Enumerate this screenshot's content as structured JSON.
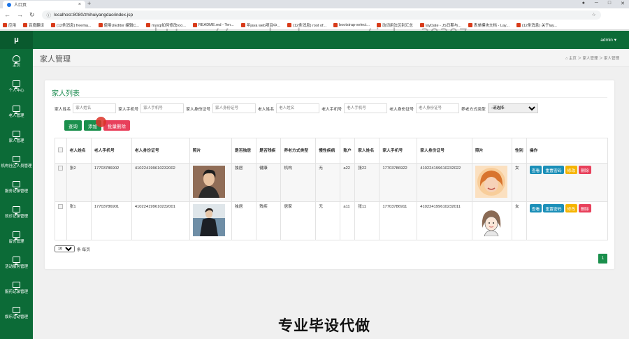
{
  "browser": {
    "tab_title": "人口页",
    "url": "localhost:8080/zhihuiyangdao/index.jsp",
    "bookmarks": [
      "应用",
      "百度翻译",
      "(12条消息) freema...",
      "使用UEditor 编辑C...",
      "mysql如何修改roo...",
      "README.md - Ten...",
      "年java web项目中...",
      "(12条消息) root of...",
      "bootstrap-select...",
      "动词用法区别汇总",
      "layDate - JS日期与...",
      "表单模块文档 - Lay...",
      "(12条消息) 关于lay..."
    ]
  },
  "watermark_text": "https://www.huzhan.com/ishop39397",
  "bottom_watermark": "专业毕设代做",
  "sidebar": {
    "logo": "μ",
    "items": [
      {
        "label": "主页",
        "icon": "dashboard-icon"
      },
      {
        "label": "个人中心",
        "icon": "monitor-icon"
      },
      {
        "label": "老人管理",
        "icon": "monitor-icon"
      },
      {
        "label": "家人管理",
        "icon": "monitor-icon"
      },
      {
        "label": "机构社区人员管理",
        "icon": "monitor-icon"
      },
      {
        "label": "服务记录管理",
        "icon": "monitor-icon"
      },
      {
        "label": "就诊记录管理",
        "icon": "monitor-icon"
      },
      {
        "label": "留言管理",
        "icon": "monitor-icon"
      },
      {
        "label": "活动服务管理",
        "icon": "monitor-icon"
      },
      {
        "label": "服药记录管理",
        "icon": "monitor-icon"
      },
      {
        "label": "娱乐活动管理",
        "icon": "monitor-icon"
      }
    ]
  },
  "header": {
    "user": "admin ▾"
  },
  "page": {
    "title": "家人管理",
    "breadcrumb": "⌂ 主页 ＞ 家人管理 ＞ 家人管理"
  },
  "card": {
    "title": "家人列表"
  },
  "filters": [
    {
      "label": "家人姓名",
      "placeholder": "家人姓名"
    },
    {
      "label": "家人手机号",
      "placeholder": "家人手机号"
    },
    {
      "label": "家人身份证号",
      "placeholder": "家人身份证号"
    },
    {
      "label": "老人姓名",
      "placeholder": "老人姓名"
    },
    {
      "label": "老人手机号",
      "placeholder": "老人手机号"
    },
    {
      "label": "老人身份证号",
      "placeholder": "老人身份证号"
    }
  ],
  "select_filter": {
    "label": "养老方式类型",
    "value": "-请选择-"
  },
  "buttons": {
    "query": "查询",
    "add": "添加",
    "batch_delete": "批量删除"
  },
  "table": {
    "headers": [
      "老人姓名",
      "老人手机号",
      "老人身份证号",
      "照片",
      "是否独居",
      "是否残疾",
      "养老方式类型",
      "慢性疾病",
      "账户",
      "家人姓名",
      "家人手机号",
      "家人身份证号",
      "照片",
      "性别",
      "操作"
    ],
    "rows": [
      {
        "name": "张2",
        "phone": "17703786902",
        "id": "410224199610232002",
        "alone": "独居",
        "disabled": "健康",
        "mode": "机构",
        "chronic": "无",
        "account": "a22",
        "family": "张22",
        "fphone": "17703786922",
        "fid": "410224199610232022",
        "gender": "女"
      },
      {
        "name": "张1",
        "phone": "17703786901",
        "id": "410224199610232001",
        "alone": "独居",
        "disabled": "残疾",
        "mode": "居家",
        "chronic": "无",
        "account": "a11",
        "family": "张11",
        "fphone": "17703786911",
        "fid": "410224199610232011",
        "gender": "女"
      }
    ],
    "actions": {
      "view": "查看",
      "reset": "重置密码",
      "edit": "修改",
      "delete": "删除"
    }
  },
  "pagination": {
    "page_size": "10",
    "per_page_label": "条 每页",
    "current": "1"
  }
}
